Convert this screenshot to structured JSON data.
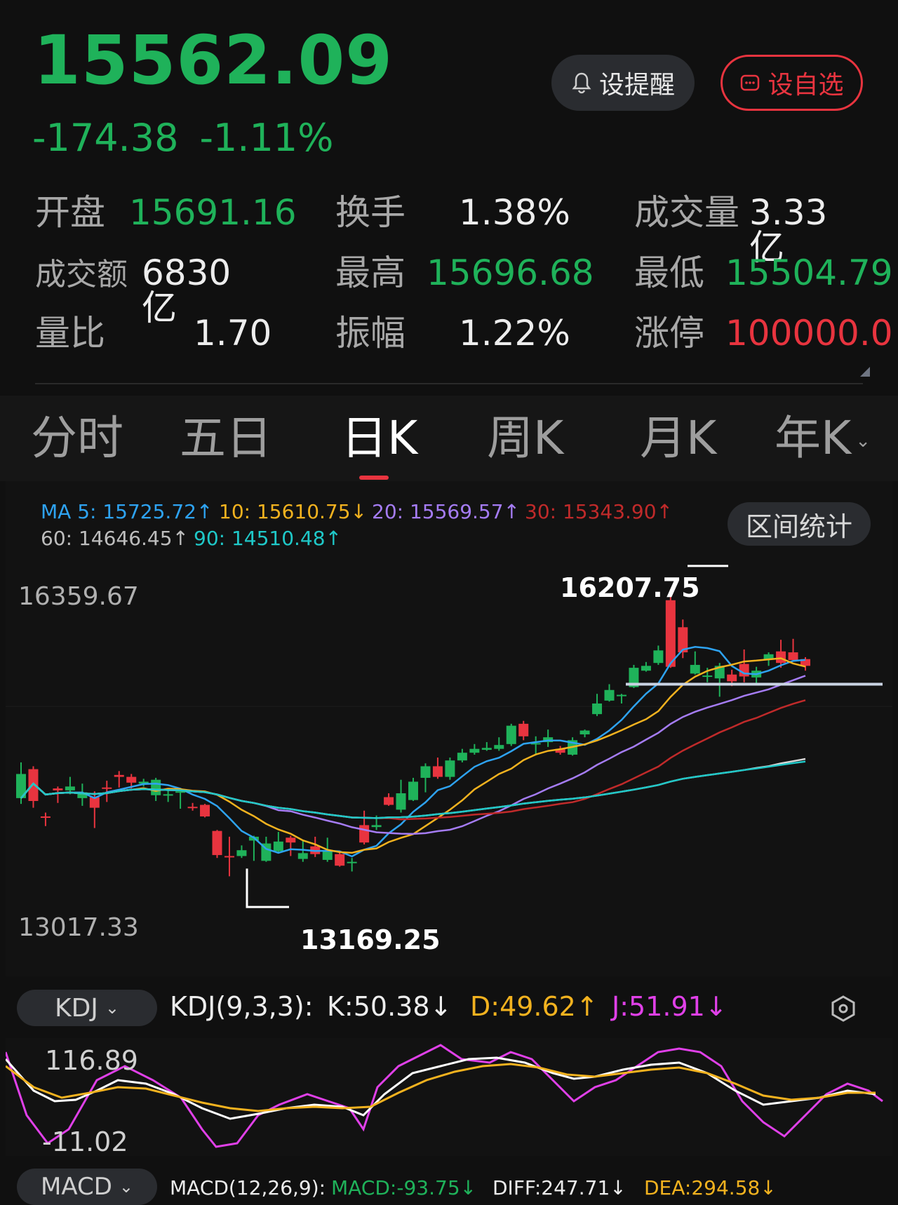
{
  "header": {
    "price": "15562.09",
    "change": "-174.38",
    "change_pct": "-1.11%",
    "alert_label": "设提醒",
    "fav_label": "设自选",
    "colors": {
      "down": "#1fb25a",
      "up": "#e8343f"
    }
  },
  "stats": {
    "open_label": "开盘",
    "open": "15691.16",
    "turnover_label": "换手",
    "turnover": "1.38%",
    "volume_label": "成交量",
    "volume": "3.33亿",
    "amount_label": "成交额",
    "amount": "6830亿",
    "high_label": "最高",
    "high": "15696.68",
    "low_label": "最低",
    "low": "15504.79",
    "ratio_label": "量比",
    "ratio": "1.70",
    "amp_label": "振幅",
    "amp": "1.22%",
    "limit_label": "涨停",
    "limit": "100000.0"
  },
  "tabs": [
    "分时",
    "五日",
    "日K",
    "周K",
    "月K",
    "年K"
  ],
  "active_tab": "日K",
  "ma": {
    "ma5": "MA 5: 15725.72↑",
    "ma10": "10: 15610.75↓",
    "ma20": "20: 15569.57↑",
    "ma30": "30: 15343.90↑",
    "ma60": "60: 14646.45↑",
    "ma90": "90: 14510.48↑",
    "colors": {
      "ma5": "#2ea3f2",
      "ma10": "#f2b21f",
      "ma20": "#a57cf4",
      "ma30": "#c02a2a",
      "ma60": "#d8d8d8",
      "ma90": "#1fc8c8"
    }
  },
  "range_btn": "区间统计",
  "kline": {
    "y_top": "16359.67",
    "y_bottom": "13017.33",
    "high_mark": "16207.75",
    "low_mark": "13169.25"
  },
  "kdj": {
    "selector": "KDJ",
    "params": "KDJ(9,3,3):",
    "k": "K:50.38↓",
    "d": "D:49.62↑",
    "j": "J:51.91↓",
    "y_top": "116.89",
    "y_bottom": "-11.02"
  },
  "macd": {
    "selector": "MACD",
    "params": "MACD(12,26,9):",
    "macd": "MACD:-93.75↓",
    "diff": "DIFF:247.71↓",
    "dea": "DEA:294.58↓"
  },
  "chart_data": {
    "type": "candlestick",
    "y_range": [
      13017.33,
      16359.67
    ],
    "annotations": [
      {
        "label": "16207.75",
        "kind": "high"
      },
      {
        "label": "13169.25",
        "kind": "low"
      }
    ],
    "candles": [
      [
        14300,
        14050,
        14420,
        13990
      ],
      [
        14020,
        14350,
        14380,
        13950
      ],
      [
        13850,
        13860,
        13900,
        13760
      ],
      [
        14130,
        14150,
        14170,
        14000
      ],
      [
        14170,
        14130,
        14270,
        14090
      ],
      [
        14110,
        14050,
        14200,
        13970
      ],
      [
        13950,
        14060,
        14120,
        13740
      ],
      [
        14150,
        14160,
        14230,
        14010
      ],
      [
        14270,
        14290,
        14330,
        14160
      ],
      [
        14210,
        14270,
        14300,
        14150
      ],
      [
        14220,
        14200,
        14250,
        14170
      ],
      [
        14240,
        14080,
        14260,
        14020
      ],
      [
        14090,
        14080,
        14150,
        14010
      ],
      [
        14120,
        14110,
        14130,
        13940
      ],
      [
        13960,
        13960,
        14000,
        13920
      ],
      [
        13860,
        13980,
        13990,
        13850
      ],
      [
        13460,
        13710,
        13720,
        13430
      ],
      [
        13450,
        13450,
        13650,
        13240
      ],
      [
        13510,
        13450,
        13560,
        13430
      ],
      [
        13650,
        13610,
        13660,
        13400
      ],
      [
        13580,
        13400,
        13650,
        13390
      ],
      [
        13600,
        13500,
        13700,
        13490
      ],
      [
        13590,
        13640,
        13660,
        13450
      ],
      [
        13480,
        13420,
        13620,
        13390
      ],
      [
        13470,
        13550,
        13650,
        13440
      ],
      [
        13500,
        13410,
        13640,
        13390
      ],
      [
        13350,
        13470,
        13500,
        13340
      ],
      [
        13390,
        13380,
        13430,
        13290
      ],
      [
        13590,
        13770,
        13920,
        13570
      ],
      [
        13770,
        13750,
        13870,
        13720
      ],
      [
        13980,
        14060,
        14100,
        13970
      ],
      [
        14100,
        13930,
        14240,
        13900
      ],
      [
        14220,
        14030,
        14260,
        14020
      ],
      [
        14380,
        14260,
        14410,
        14110
      ],
      [
        14270,
        14380,
        14470,
        14250
      ],
      [
        14440,
        14270,
        14470,
        14240
      ],
      [
        14520,
        14440,
        14560,
        14420
      ],
      [
        14560,
        14520,
        14610,
        14500
      ],
      [
        14570,
        14550,
        14630,
        14540
      ],
      [
        14600,
        14560,
        14680,
        14540
      ],
      [
        14800,
        14610,
        14820,
        14590
      ],
      [
        14690,
        14820,
        14850,
        14650
      ],
      [
        14620,
        14610,
        14690,
        14510
      ],
      [
        14680,
        14630,
        14760,
        14580
      ],
      [
        14520,
        14560,
        14590,
        14500
      ],
      [
        14650,
        14500,
        14680,
        14490
      ],
      [
        14750,
        14710,
        14760,
        14680
      ],
      [
        15030,
        14920,
        15130,
        14900
      ],
      [
        15170,
        15060,
        15230,
        15050
      ],
      [
        15120,
        15110,
        15130,
        15030
      ],
      [
        15400,
        15200,
        15430,
        15190
      ],
      [
        15420,
        15370,
        15460,
        15360
      ],
      [
        15580,
        15450,
        15630,
        15430
      ],
      [
        15410,
        16100,
        16210,
        15400
      ],
      [
        15560,
        15820,
        15900,
        15500
      ],
      [
        15430,
        15340,
        15570,
        15330
      ],
      [
        15320,
        15310,
        15400,
        15250
      ],
      [
        15420,
        15290,
        15450,
        15100
      ],
      [
        15260,
        15330,
        15380,
        15210
      ],
      [
        15310,
        15440,
        15590,
        15250
      ],
      [
        15370,
        15300,
        15410,
        15230
      ],
      [
        15540,
        15490,
        15560,
        15420
      ],
      [
        15450,
        15570,
        15690,
        15400
      ],
      [
        15480,
        15560,
        15700,
        15490
      ],
      [
        15420,
        15490,
        15510,
        15370
      ]
    ]
  }
}
